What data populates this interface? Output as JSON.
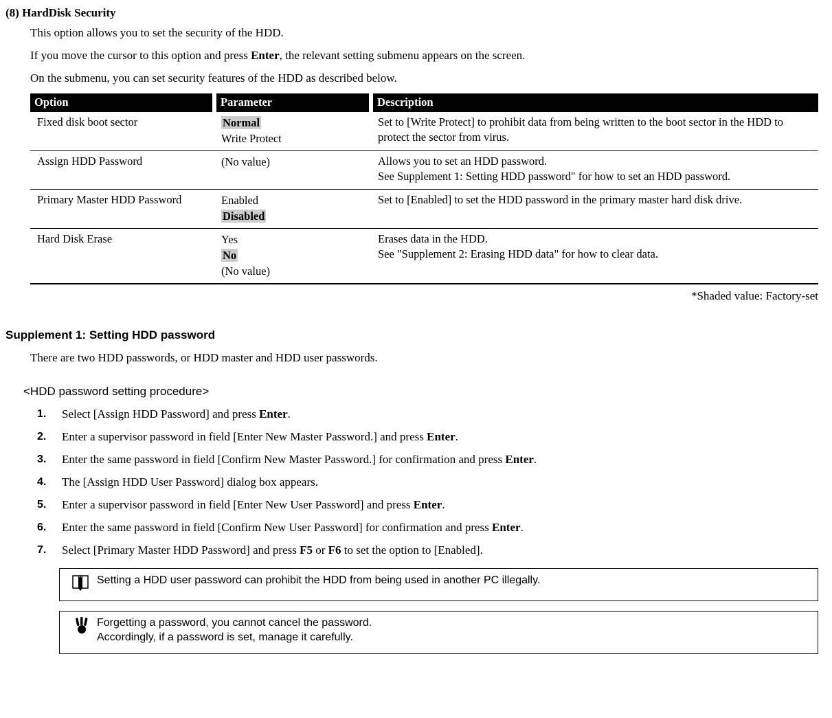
{
  "section_title": "(8) HardDisk Security",
  "intro1": "This option allows you to set the security of the HDD.",
  "intro2_a": "If you move the cursor to this option and press ",
  "intro2_b": "Enter",
  "intro2_c": ", the relevant setting submenu appears on the screen.",
  "intro3": "On the submenu, you can set security features of the HDD as described below.",
  "headers": {
    "option": "Option",
    "parameter": "Parameter",
    "description": "Description"
  },
  "rows": {
    "r0": {
      "option": "Fixed disk boot sector",
      "p0": "Normal",
      "p1": "Write Protect",
      "desc": "Set to [Write Protect] to prohibit data from being written to the boot sector in the HDD to protect the sector from virus."
    },
    "r1": {
      "option": "Assign HDD Password",
      "p0": "(No value)",
      "desc0": "Allows you to set an HDD password.",
      "desc1": "See Supplement 1: Setting HDD password\" for how to set an HDD password."
    },
    "r2": {
      "option": "Primary Master HDD Password",
      "p0": "Enabled",
      "p1": "Disabled",
      "desc": "Set to [Enabled] to set the HDD password in the primary master hard disk drive."
    },
    "r3": {
      "option": "Hard Disk Erase",
      "p0": "Yes",
      "p1": "No",
      "p2": "(No value)",
      "desc0": "Erases data in the HDD.",
      "desc1": "See \"Supplement 2: Erasing HDD data\" for how to clear data."
    }
  },
  "table_note": "*Shaded value: Factory-set",
  "supp1_title": "Supplement 1: Setting HDD password",
  "supp1_intro": "There are two HDD passwords, or HDD master and HDD user passwords.",
  "proc_title": "<HDD password setting procedure>",
  "steps": {
    "s1_a": "Select [Assign HDD Password] and press ",
    "s1_b": "Enter",
    "s1_c": ".",
    "s2_a": "Enter a supervisor password in field [Enter New Master Password.] and press ",
    "s2_b": "Enter",
    "s2_c": ".",
    "s3_a": "Enter the same password in field [Confirm New Master Password.] for confirmation and press ",
    "s3_b": "Enter",
    "s3_c": ".",
    "s4": "The [Assign HDD User Password] dialog box appears.",
    "s5_a": "Enter a supervisor password in field [Enter New User Password] and press ",
    "s5_b": "Enter",
    "s5_c": ".",
    "s6_a": "Enter the same password in field [Confirm New User Password] for confirmation and press ",
    "s6_b": "Enter",
    "s6_c": ".",
    "s7_a": "Select [Primary Master HDD Password] and press ",
    "s7_b": "F5",
    "s7_c": " or ",
    "s7_d": "F6",
    "s7_e": " to set the option to [Enabled]."
  },
  "note1": "Setting a HDD user password can prohibit the HDD from being used in another PC illegally.",
  "note2_l1": "Forgetting a password, you cannot cancel the password.",
  "note2_l2": "Accordingly, if a password is set, manage it carefully."
}
